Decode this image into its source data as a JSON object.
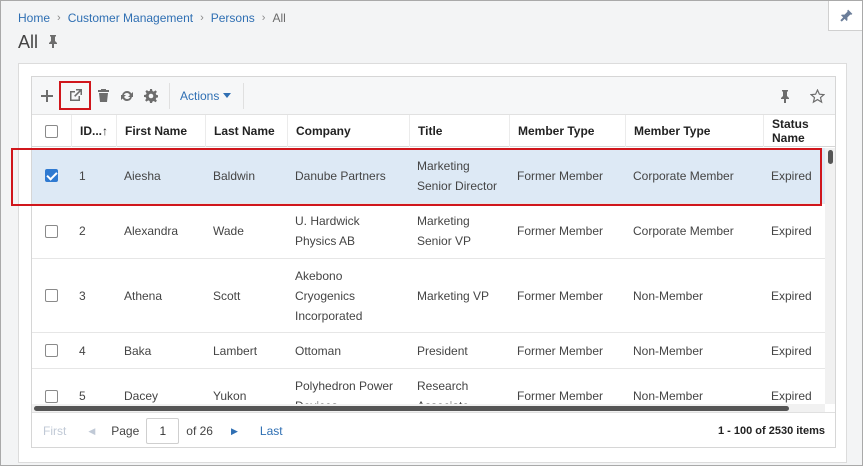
{
  "breadcrumb": [
    "Home",
    "Customer Management",
    "Persons",
    "All"
  ],
  "page_title": "All",
  "toolbar": {
    "icons": [
      "add-icon",
      "open-external-icon",
      "trash-icon",
      "refresh-icon",
      "gear-icon"
    ],
    "actions_label": "Actions",
    "right_icons": [
      "pin-icon",
      "star-icon"
    ]
  },
  "columns": [
    "ID...↑",
    "First Name",
    "Last Name",
    "Company",
    "Title",
    "Member Type",
    "Member Type",
    "Status Name"
  ],
  "rows": [
    {
      "id": "1",
      "first": "Aiesha",
      "last": "Baldwin",
      "company": [
        "Danube Partners"
      ],
      "title": [
        "Marketing",
        "Senior Director"
      ],
      "member1": "Former Member",
      "member2": "Corporate Member",
      "status": "Expired",
      "checked": true
    },
    {
      "id": "2",
      "first": "Alexandra",
      "last": "Wade",
      "company": [
        "U. Hardwick",
        "Physics AB"
      ],
      "title": [
        "Marketing",
        "Senior VP"
      ],
      "member1": "Former Member",
      "member2": "Corporate Member",
      "status": "Expired",
      "checked": false
    },
    {
      "id": "3",
      "first": "Athena",
      "last": "Scott",
      "company": [
        "Akebono",
        "Cryogenics",
        "Incorporated"
      ],
      "title": [
        "Marketing VP"
      ],
      "member1": "Former Member",
      "member2": "Non-Member",
      "status": "Expired",
      "checked": false
    },
    {
      "id": "4",
      "first": "Baka",
      "last": "Lambert",
      "company": [
        "Ottoman"
      ],
      "title": [
        "President"
      ],
      "member1": "Former Member",
      "member2": "Non-Member",
      "status": "Expired",
      "checked": false
    },
    {
      "id": "5",
      "first": "Dacey",
      "last": "Yukon",
      "company": [
        "Polyhedron Power",
        "Devices"
      ],
      "title": [
        "Research",
        "Associate"
      ],
      "member1": "Former Member",
      "member2": "Non-Member",
      "status": "Expired",
      "checked": false
    }
  ],
  "pager": {
    "first": "First",
    "page_label": "Page",
    "page_value": "1",
    "of_label": "of 26",
    "last": "Last",
    "count": "1 - 100 of 2530 items"
  },
  "colors": {
    "link": "#2f6fb3",
    "selected_row": "#dde9f5",
    "highlight": "#d0161c",
    "checkbox": "#2f7ad1"
  }
}
